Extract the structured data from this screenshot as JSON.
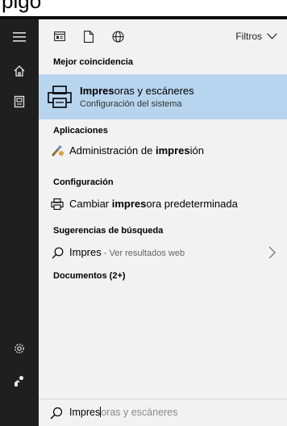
{
  "background_fragment": "pigo",
  "toolbar": {
    "filters_label": "Filtros"
  },
  "sections": {
    "best_match": "Mejor coincidencia",
    "apps": "Aplicaciones",
    "settings": "Configuración",
    "suggestions": "Sugerencias de búsqueda",
    "documents": "Documentos (2+)"
  },
  "best_match": {
    "title_bold": "Impres",
    "title_rest": "oras y escáneres",
    "subtitle": "Configuración del sistema"
  },
  "apps": {
    "item": {
      "pre": "Administración de ",
      "bold": "impres",
      "post": "ión"
    }
  },
  "settings_items": {
    "item": {
      "pre": "Cambiar ",
      "bold": "impres",
      "post": "ora predeterminada"
    }
  },
  "suggestion": {
    "term": "Impres",
    "sep": " - ",
    "web": "Ver resultados web"
  },
  "search": {
    "typed": "Impres",
    "hint": "oras y escáneres"
  },
  "colors": {
    "rail": "#1f1f1f",
    "panel": "#f2f2f2",
    "highlight": "#b8d5ef"
  },
  "icons": {
    "rail": [
      "hamburger-menu-icon",
      "home-icon",
      "notebook-icon",
      "settings-gear-icon",
      "feedback-icon"
    ],
    "toolbar": [
      "apps-filter-icon",
      "documents-filter-icon",
      "web-filter-icon",
      "chevron-down-icon"
    ],
    "results": [
      "printer-icon",
      "print-management-icon",
      "printer-small-icon",
      "search-icon",
      "chevron-right-icon"
    ]
  }
}
